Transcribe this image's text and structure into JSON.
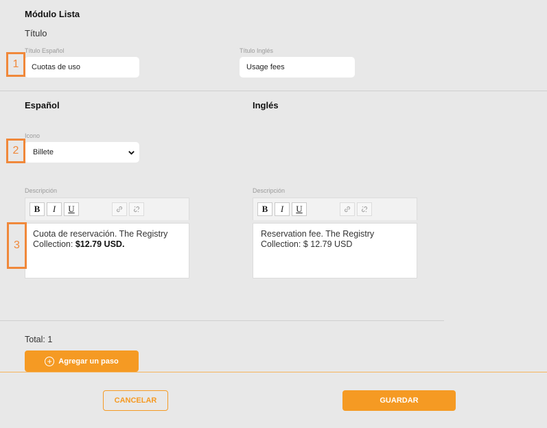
{
  "module": {
    "title": "Módulo Lista",
    "subtitle": "Título"
  },
  "titles": {
    "es_label": "Título Español",
    "es_value": "Cuotas de uso",
    "en_label": "Título Inglés",
    "en_value": "Usage fees"
  },
  "columns": {
    "es_header": "Español",
    "en_header": "Inglés"
  },
  "icon_field": {
    "label": "Icono",
    "selected": "Billete"
  },
  "description": {
    "es_label": "Descripción",
    "en_label": "Descripción",
    "es_text": "Cuota de reservación. The Registry Collection: ",
    "es_bold": "$12.79 USD.",
    "en_text": "Reservation fee. The Registry Collection: $ 12.79 USD"
  },
  "toolbar": {
    "bold": "B",
    "italic": "I",
    "underline": "U"
  },
  "markers": [
    "1",
    "2",
    "3"
  ],
  "footer": {
    "total": "Total: 1",
    "add_step": "Agregar un paso",
    "cancel": "CANCELAR",
    "save": "GUARDAR"
  },
  "colors": {
    "accent": "#f59a23",
    "marker": "#f0883a",
    "background": "#e8e8e8"
  }
}
